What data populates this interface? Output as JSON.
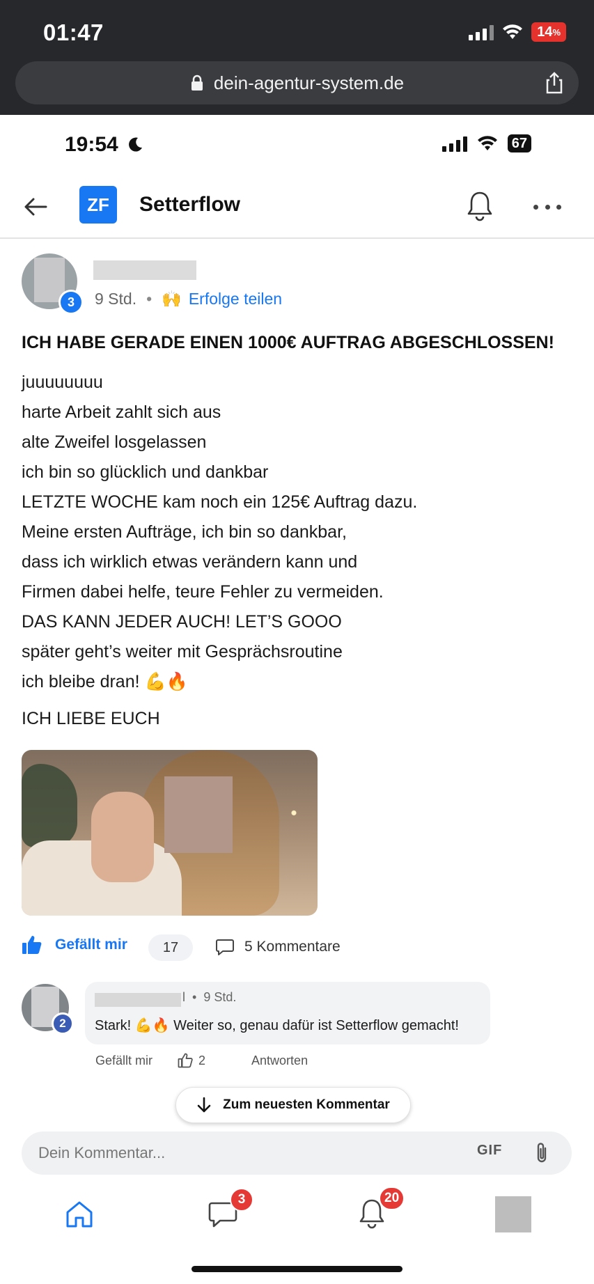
{
  "browser": {
    "time": "01:47",
    "battery": "14",
    "url": "dein-agentur-system.de"
  },
  "phone": {
    "time": "19:54",
    "battery": "67"
  },
  "app": {
    "logo": "ZF",
    "title": "Setterflow"
  },
  "post": {
    "author_level": "3",
    "time_ago": "9 Std.",
    "category_emoji": "🙌",
    "category": "Erfolge teilen",
    "title": "ICH HABE GERADE EINEN 1000€ AUFTRAG ABGESCHLOSSEN!",
    "lines": [
      "juuuuuuuu",
      "harte Arbeit zahlt sich aus",
      "alte Zweifel losgelassen",
      "ich bin so glücklich und dankbar",
      "LETZTE WOCHE kam noch ein 125€ Auftrag dazu.",
      "Meine ersten Aufträge, ich bin so dankbar,",
      "dass ich wirklich etwas verändern kann und",
      "Firmen dabei helfe, teure Fehler zu vermeiden.",
      "DAS KANN JEDER AUCH! LET’S GOOO",
      "später geht’s weiter mit Gesprächsroutine",
      "ich bleibe dran! 💪🔥"
    ],
    "closing": "ICH LIEBE EUCH",
    "like_label": "Gefällt mir",
    "like_count": "17",
    "comments_label": "5 Kommentare"
  },
  "comment": {
    "author_level": "2",
    "name_suffix": "l",
    "time_ago": "9 Std.",
    "text": "Stark! 💪🔥 Weiter so, genau dafür ist Setterflow gemacht!",
    "like_label": "Gefällt mir",
    "like_count": "2",
    "reply_label": "Antworten"
  },
  "newest_comment_label": "Zum neuesten Kommentar",
  "comment_input": {
    "placeholder": "Dein Kommentar...",
    "gif_label": "GIF"
  },
  "bottom_nav": {
    "chat_badge": "3",
    "notifications_badge": "20"
  },
  "colors": {
    "accent": "#1877f2",
    "badge_red": "#e53935",
    "chrome_bg": "#26282b"
  }
}
